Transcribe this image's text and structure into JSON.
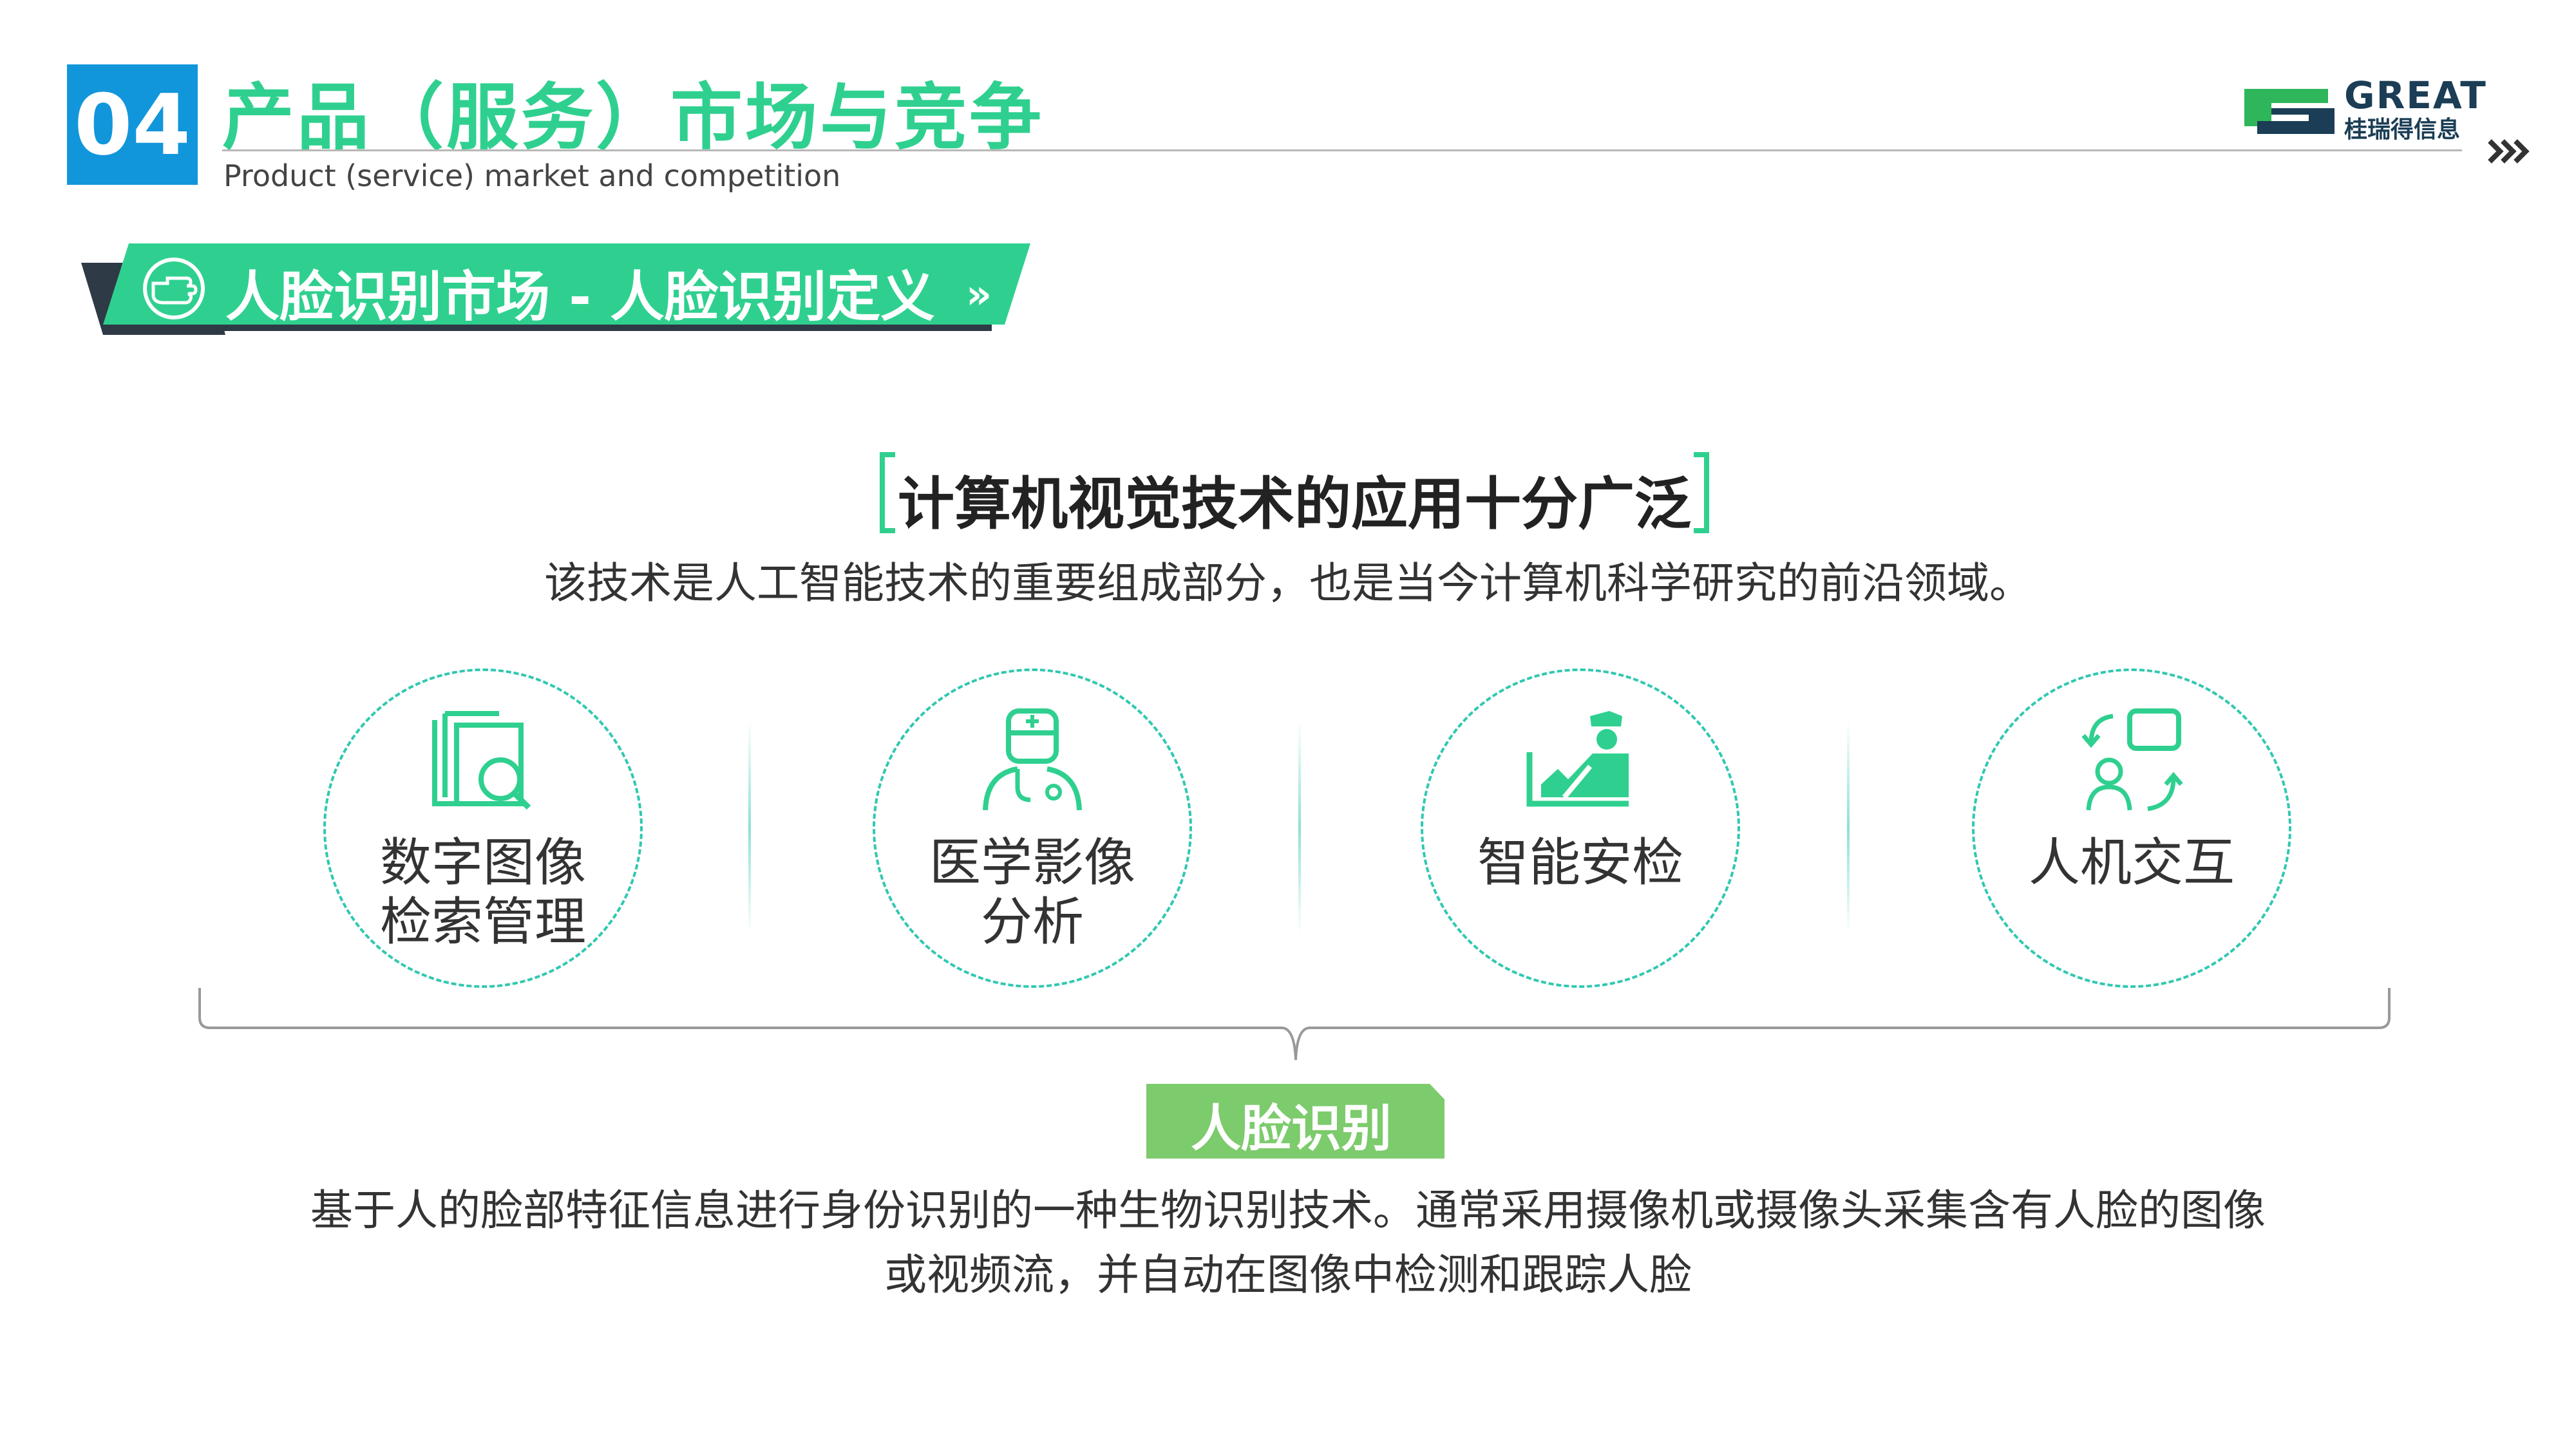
{
  "header": {
    "section_number": "04",
    "title": "产品（服务）市场与竞争",
    "subtitle": "Product (service) market and competition",
    "logo_text": "GREAT",
    "logo_cn": "桂瑞得信息",
    "nav_icon": "double-chevron-right-icon"
  },
  "banner": {
    "icon": "pointing-hand-icon",
    "text": "人脸识别市场 - 人脸识别定义",
    "arrow": "»"
  },
  "intro": {
    "heading": "计算机视觉技术的应用十分广泛",
    "lead": "该技术是人工智能技术的重要组成部分，也是当今计算机科学研究的前沿领域。"
  },
  "applications": [
    {
      "label": "数字图像\n检索管理",
      "icon": "image-search-icon"
    },
    {
      "label": "医学影像\n分析",
      "icon": "doctor-icon"
    },
    {
      "label": "智能安检",
      "icon": "security-check-icon"
    },
    {
      "label": "人机交互",
      "icon": "human-computer-interaction-icon"
    }
  ],
  "face_recognition": {
    "tag": "人脸识别",
    "description_line1": "基于人的脸部特征信息进行身份识别的一种生物识别技术。通常采用摄像机或摄像头采集含有人脸的图像",
    "description_line2": "或视频流，并自动在图像中检测和跟踪人脸"
  },
  "colors": {
    "blue": "#1296DB",
    "green": "#2FD08F",
    "dark": "#2E3A46",
    "teal": "#2FC8B0",
    "tag_green": "#7CCB6C"
  }
}
